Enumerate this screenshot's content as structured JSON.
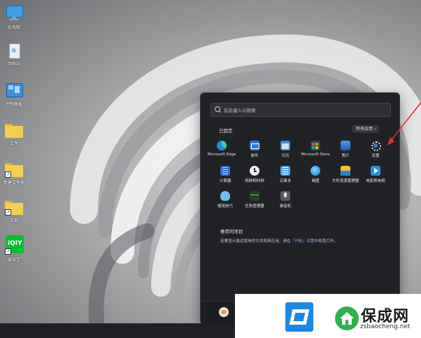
{
  "desktop": {
    "icons": [
      {
        "label": "此电脑",
        "icon": "monitor-icon"
      },
      {
        "label": "回收站",
        "icon": "recycle-bin-icon"
      },
      {
        "label": "控制面板",
        "icon": "control-panel-icon"
      },
      {
        "label": "文件",
        "icon": "folder-icon"
      },
      {
        "label": "新建文件夹",
        "icon": "folder-icon"
      },
      {
        "label": "文档",
        "icon": "folder-icon"
      },
      {
        "label": "爱奇艺",
        "icon": "iqiyi-icon"
      }
    ]
  },
  "start_menu": {
    "search_placeholder": "在此键入以搜索",
    "pinned_title": "已固定",
    "all_apps_label": "所有应用 ›",
    "pinned_apps": [
      {
        "name": "Microsoft Edge",
        "icon": "edge-icon",
        "color": "#2ea8e0"
      },
      {
        "name": "邮件",
        "icon": "mail-icon",
        "color": "#2b7cd3"
      },
      {
        "name": "日历",
        "icon": "calendar-icon",
        "color": "#3a8be0"
      },
      {
        "name": "Microsoft Store",
        "icon": "store-icon",
        "color": "#404048"
      },
      {
        "name": "照片",
        "icon": "photos-icon",
        "color": "#3b7ecf"
      },
      {
        "name": "设置",
        "icon": "settings-gear-icon",
        "color": "#5a6b7e"
      },
      {
        "name": "计算器",
        "icon": "calculator-icon",
        "color": "#2e6fd0"
      },
      {
        "name": "闹钟和时钟",
        "icon": "clock-icon",
        "color": "#e8e8e8"
      },
      {
        "name": "记事本",
        "icon": "notepad-icon",
        "color": "#4aa6e8"
      },
      {
        "name": "画图",
        "icon": "paint-icon",
        "color": "#3ba6e0"
      },
      {
        "name": "文件资源管理器",
        "icon": "file-explorer-icon",
        "color": "#f2c230"
      },
      {
        "name": "电影和电视",
        "icon": "movies-tv-icon",
        "color": "#2b8fe0"
      },
      {
        "name": "使用技巧",
        "icon": "tips-icon",
        "color": "#6ec0ee"
      },
      {
        "name": "任务管理器",
        "icon": "task-manager-icon",
        "color": "#5bb15b"
      },
      {
        "name": "录音机",
        "icon": "recorder-icon",
        "color": "#555860"
      }
    ],
    "recommended_title": "推荐的项目",
    "recommended_text": "若要显示最近使用的文件和新应用，请在",
    "recommended_text_mid": "「开始」设置",
    "recommended_text_end": "中将其打开。"
  },
  "watermark": {
    "title": "保成网",
    "url": "zsbaocheng.net"
  },
  "colors": {
    "start_bg": "#202225",
    "accent": "#1a87e8",
    "arrow": "#e53030"
  }
}
